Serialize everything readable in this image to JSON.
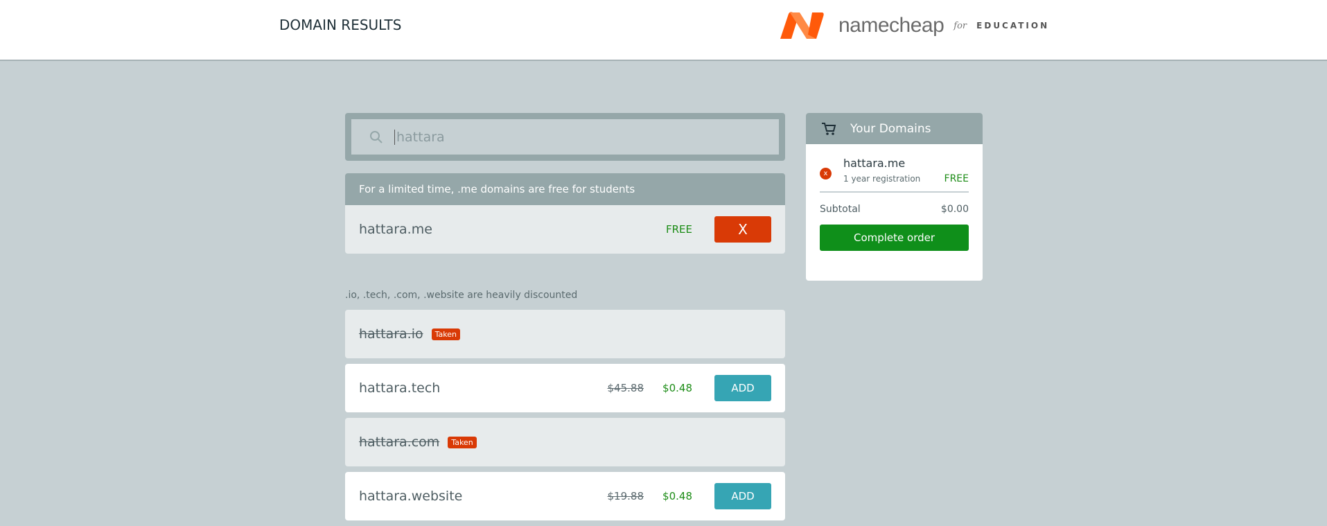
{
  "header": {
    "title": "DOMAIN RESULTS",
    "logo": {
      "word": "namecheap",
      "for": "for",
      "edu": "EDUCATION"
    }
  },
  "search": {
    "value": "hattara",
    "icon": "search-icon"
  },
  "promo": {
    "heading": "For a limited time, .me domains are free for students",
    "domain": "hattara.me",
    "price": "FREE",
    "remove_label": "X"
  },
  "discount": {
    "heading": ".io, .tech, .com, .website are heavily discounted",
    "rows": [
      {
        "domain": "hattara.io",
        "badge": "Taken"
      },
      {
        "domain": "hattara.tech",
        "old_price": "$45.88",
        "price": "$0.48",
        "action": "ADD"
      },
      {
        "domain": "hattara.com",
        "badge": "Taken"
      },
      {
        "domain": "hattara.website",
        "old_price": "$19.88",
        "price": "$0.48",
        "action": "ADD"
      }
    ]
  },
  "cart": {
    "title": "Your Domains",
    "item": {
      "domain": "hattara.me",
      "term": "1 year registration",
      "price": "FREE",
      "remove": "x"
    },
    "subtotal_label": "Subtotal",
    "subtotal": "$0.00",
    "complete_label": "Complete order"
  },
  "colors": {
    "accent": "#36a5b4",
    "danger": "#d93a06",
    "success": "#0f8f1a",
    "brand": "#ff6a13"
  }
}
